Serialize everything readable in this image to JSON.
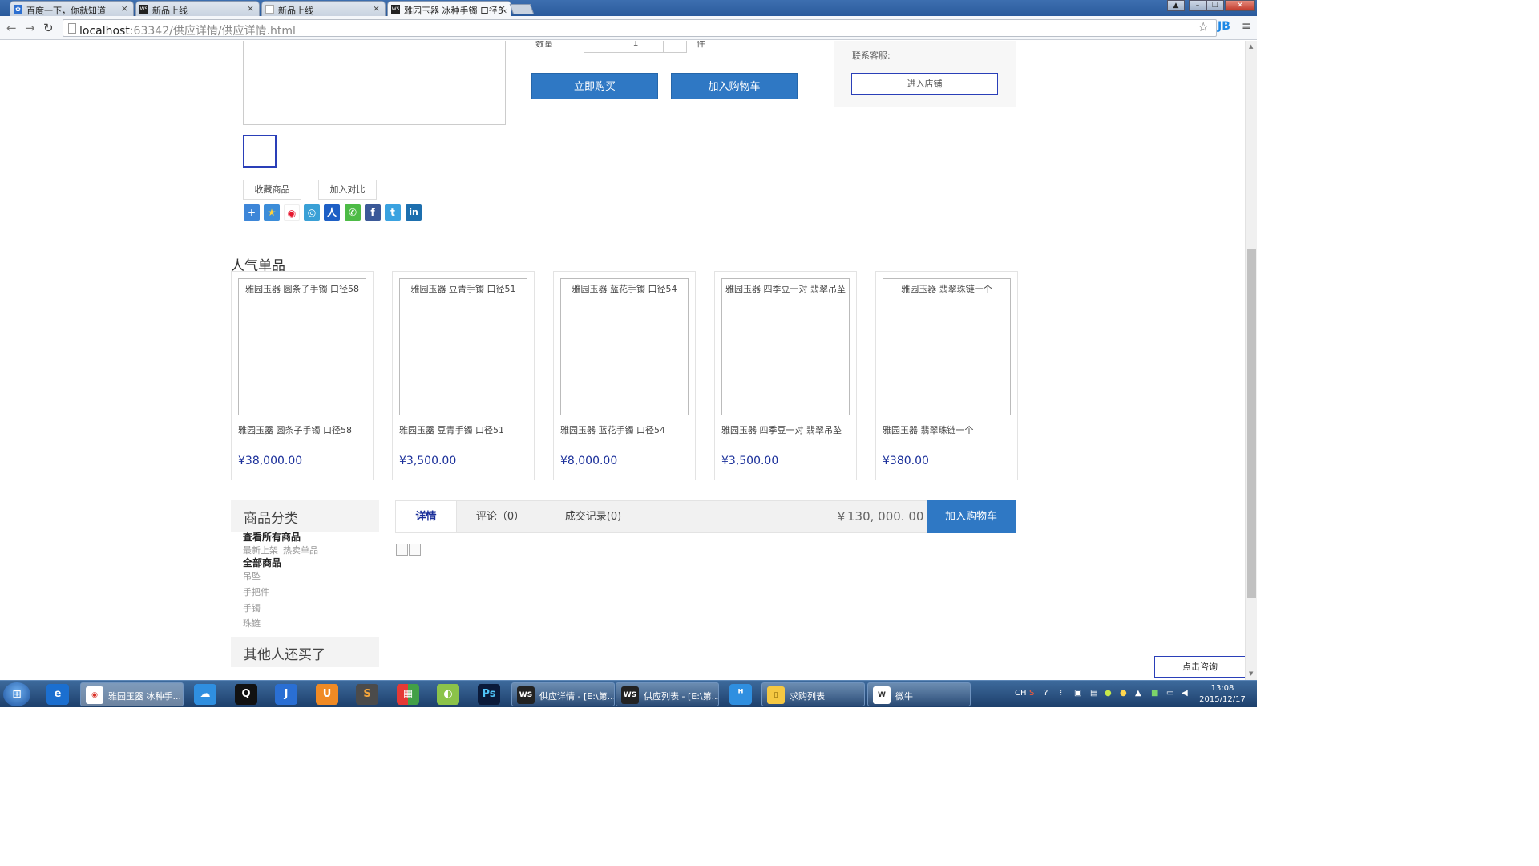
{
  "browser": {
    "tabs": [
      {
        "label": "百度一下，你就知道",
        "close": "×"
      },
      {
        "label": "新品上线",
        "close": "×"
      },
      {
        "label": "新品上线",
        "close": "×"
      },
      {
        "label": "雅园玉器 冰种手镯 口径5‹",
        "close": "×"
      }
    ],
    "url_host": "localhost",
    "url_rest": ":63342/供应详情/供应详情.html",
    "extension_label": "JB"
  },
  "purchase": {
    "qty_label": "数量",
    "qty_value": "1",
    "qty_unit": "件",
    "buy_now": "立即购买",
    "add_to_cart": "加入购物车"
  },
  "shop": {
    "contact_label": "联系客服:",
    "enter_shop": "进入店铺"
  },
  "gallery": {
    "favorite": "收藏商品",
    "compare": "加入对比"
  },
  "share_icons": [
    "plus-icon",
    "qzone-star-icon",
    "weibo-icon",
    "tencent-weibo-icon",
    "renren-icon",
    "wechat-icon",
    "facebook-icon",
    "twitter-icon",
    "linkedin-icon"
  ],
  "popular": {
    "title": "人气单品",
    "items": [
      {
        "alt": "雅园玉器 圆条子手镯 口径58",
        "name": "雅园玉器 圆条子手镯 口径58",
        "price": "¥38,000.00"
      },
      {
        "alt": "雅园玉器 豆青手镯 口径51",
        "name": "雅园玉器 豆青手镯 口径51",
        "price": "¥3,500.00"
      },
      {
        "alt": "雅园玉器 蓝花手镯 口径54",
        "name": "雅园玉器 蓝花手镯 口径54",
        "price": "¥8,000.00"
      },
      {
        "alt": "雅园玉器 四季豆一对 翡翠吊坠",
        "name": "雅园玉器 四季豆一对 翡翠吊坠",
        "price": "¥3,500.00"
      },
      {
        "alt": "雅园玉器 翡翠珠链一个",
        "name": "雅园玉器 翡翠珠链一个",
        "price": "¥380.00"
      }
    ]
  },
  "categories": {
    "title": "商品分类",
    "view_all": "查看所有商品",
    "quick_links": [
      "最新上架",
      "热卖单品"
    ],
    "all_goods": "全部商品",
    "items": [
      "吊坠",
      "手把件",
      "手镯",
      "珠链"
    ],
    "others_bought": "其他人还买了"
  },
  "detail_tabs": {
    "tabs": [
      "详情",
      "评论（0）",
      "成交记录(0)"
    ],
    "price": "￥130, 000. 00",
    "add_to_cart": "加入购物车"
  },
  "consult_button": "点击咨询",
  "taskbar": {
    "tasks": [
      {
        "label": "雅园玉器 冰种手...",
        "icon": "chrome-icon"
      },
      {
        "label": "供应详情 - [E:\\第...",
        "icon": "webstorm-icon"
      },
      {
        "label": "供应列表 - [E:\\第...",
        "icon": "webstorm-icon"
      },
      {
        "label": "求购列表",
        "icon": "folder-icon"
      },
      {
        "label": "微牛",
        "icon": "app-icon"
      }
    ],
    "lang": "CH",
    "time": "13:08",
    "date": "2015/12/17"
  },
  "colors": {
    "accent": "#2f78c4",
    "price": "#1a2f9a",
    "taskbar": "#2a5283"
  }
}
